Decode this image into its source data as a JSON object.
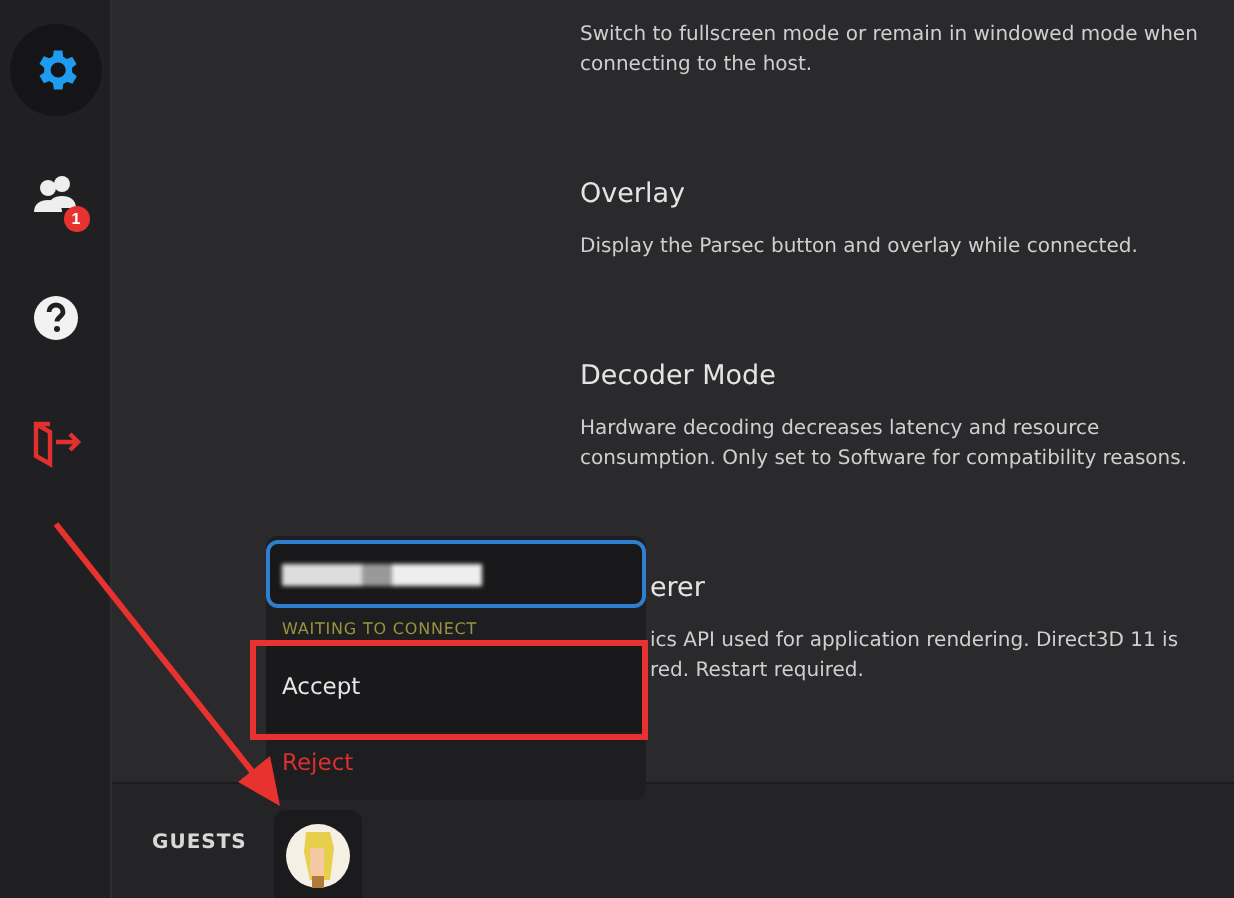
{
  "sidebar": {
    "items": [
      {
        "kind": "settings",
        "selected": true
      },
      {
        "kind": "guests",
        "selected": false,
        "badge": "1"
      },
      {
        "kind": "help",
        "selected": false
      },
      {
        "kind": "exit",
        "selected": false
      }
    ]
  },
  "settings": [
    {
      "lines": [
        "Switch to fullscreen mode or remain in windowed mode when",
        "connecting to the host."
      ],
      "covered_by_menu": false
    },
    {
      "heading": "Overlay",
      "lines": [
        "Display the Parsec button and overlay while connected."
      ],
      "covered_by_menu": false
    },
    {
      "heading": "Decoder Mode",
      "lines": [
        "Hardware decoding decreases latency and resource",
        "consumption. Only set to Software for compatibility reasons."
      ],
      "covered_by_menu": false
    },
    {
      "heading": "erer",
      "lines": [
        "ics API used for application rendering. Direct3D 11 is",
        "red. Restart required."
      ],
      "covered_by_menu": true
    }
  ],
  "guest_menu": {
    "status": "WAITING TO CONNECT",
    "actions": [
      {
        "label": "Accept",
        "kind": "accept",
        "highlighted": true
      },
      {
        "label": "Reject",
        "kind": "reject",
        "highlighted": false
      }
    ]
  },
  "bottom_bar": {
    "label": "GUESTS"
  }
}
